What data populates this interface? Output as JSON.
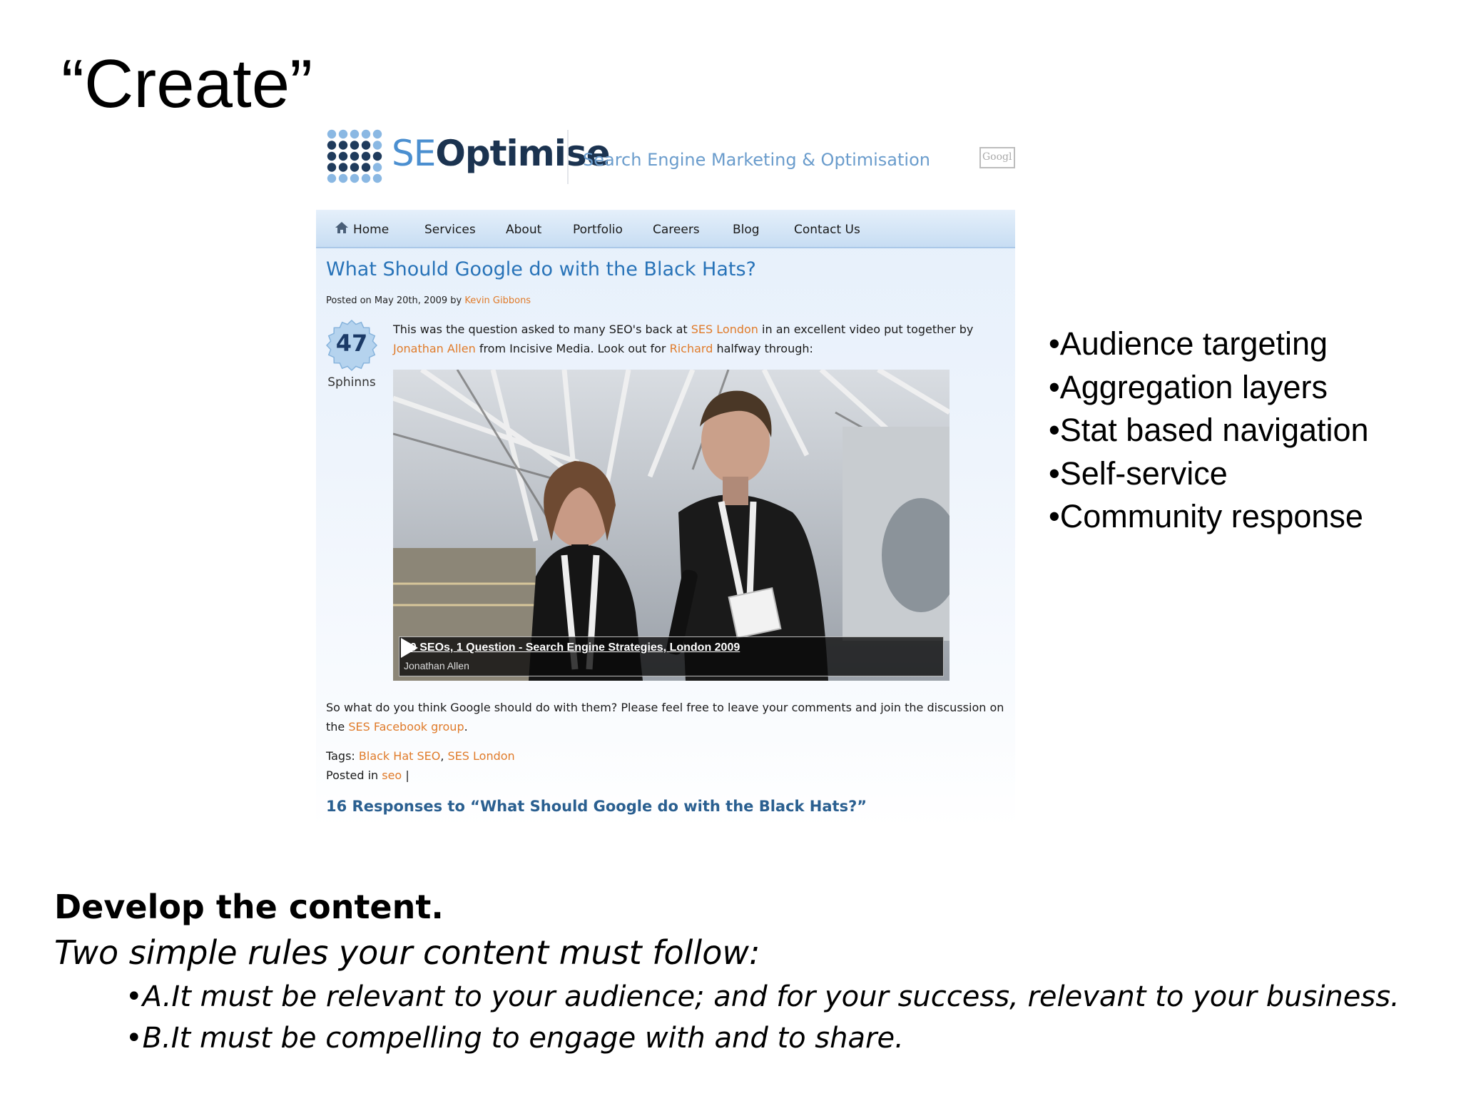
{
  "slide": {
    "title": "“Create”"
  },
  "screenshot": {
    "logo": {
      "prefix": "SE",
      "suffix": "Optimise"
    },
    "tagline": "Search Engine Marketing & Optimisation",
    "search_box_text": "Googl",
    "nav": [
      "Home",
      "Services",
      "About",
      "Portfolio",
      "Careers",
      "Blog",
      "Contact Us"
    ],
    "post": {
      "title": "What Should Google do with the Black Hats?",
      "posted_prefix": "Posted on May 20th, 2009 by",
      "author": "Kevin Gibbons",
      "sphinns_count": "47",
      "sphinns_label": "Sphinns",
      "intro_1": "This was the question asked to many SEO's back at",
      "intro_link_1": "SES London",
      "intro_2": "in an excellent video put together by",
      "intro_link_2": "Jonathan Allen",
      "intro_3": "from Incisive Media. Look out for",
      "intro_link_3": "Richard",
      "intro_4": "halfway through:",
      "video_title": "50 SEOs, 1 Question - Search Engine Strategies, London 2009",
      "video_author": "Jonathan Allen",
      "question_text": "So what do you think Google should do with them? Please feel free to leave your comments and join the discussion on the",
      "question_link": "SES Facebook group",
      "question_end": ".",
      "tags_label": "Tags:",
      "tag_1": "Black Hat SEO",
      "tag_sep": ",",
      "tag_2": "SES London",
      "posted_in_label": "Posted in",
      "category": "seo",
      "category_sep": "|",
      "responses": "16 Responses to “What Should Google do with the Black Hats?”"
    }
  },
  "bullets": [
    "•Audience targeting",
    "•Aggregation layers",
    "•Stat based navigation",
    "•Self-service",
    "•Community response"
  ],
  "footer": {
    "heading": "Develop the content.",
    "subheading": "Two simple rules your content must follow:",
    "rule_a": "•A.It must be relevant to your audience; and for your success, relevant to your business.",
    "rule_b": "•B.It must be compelling to engage with and to share."
  },
  "colors": {
    "link_orange": "#e07b2a",
    "title_blue": "#2873b8",
    "brand_navy": "#1b3350"
  }
}
